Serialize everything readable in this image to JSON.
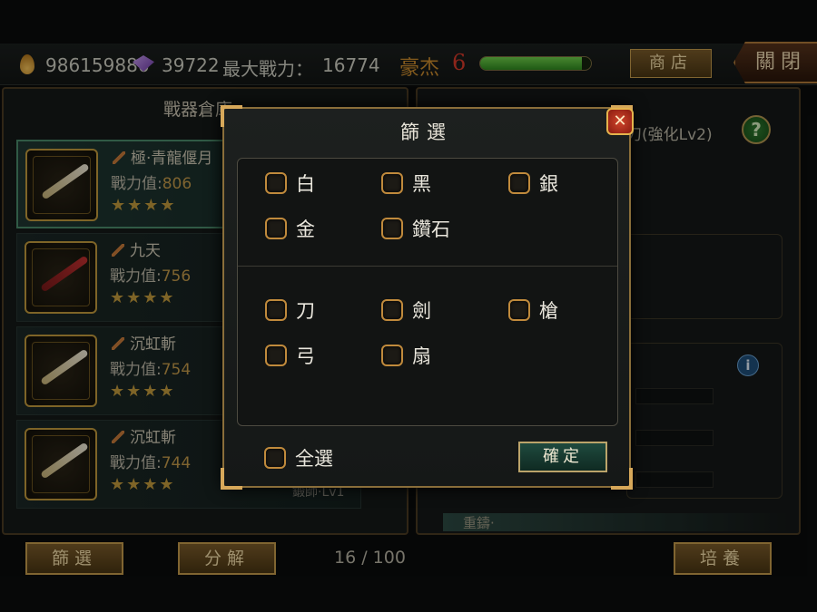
{
  "topbar": {
    "gold": "986159886",
    "gems": "39722",
    "max_power_label": "最大戰力：",
    "max_power_value": "16774",
    "rank_label": "豪杰",
    "rank_level": "6",
    "hp_fraction": 0.92,
    "shop_label": "商店",
    "close_label": "關閉"
  },
  "list_panel": {
    "title": "戰器倉庫",
    "items": [
      {
        "name": "極·青龍偃月",
        "power_label": "戰力值:",
        "power": "806",
        "stars": "★★★★"
      },
      {
        "name": "九天",
        "power_label": "戰力值:",
        "power": "756",
        "stars": "★★★★"
      },
      {
        "name": "沉虹斬",
        "power_label": "戰力值:",
        "power": "754",
        "stars": "★★★★"
      },
      {
        "name": "沉虹斬",
        "power_label": "戰力值:",
        "power": "744",
        "stars": "★★★★"
      }
    ],
    "partial_text": "鍛師·Lv1"
  },
  "detail_panel": {
    "title": "刀(強化Lv2)",
    "help": "?",
    "info": "i",
    "bottom_strip": "重鑄·"
  },
  "bottom_bar": {
    "filter_label": "篩選",
    "decompose_label": "分解",
    "page_count": "16 / 100",
    "cultivate_label": "培養"
  },
  "modal": {
    "title": "篩選",
    "close": "✕",
    "quality_options": [
      "白",
      "黑",
      "銀",
      "金",
      "鑽石"
    ],
    "type_options": [
      "刀",
      "劍",
      "槍",
      "弓",
      "扇"
    ],
    "select_all": "全選",
    "confirm": "確定"
  },
  "colors": {
    "gold_accent": "#c29a3c",
    "checkbox_border": "#c08a3c",
    "confirm_bg": "#1f4a3e",
    "rank_red": "#d83a2a"
  }
}
